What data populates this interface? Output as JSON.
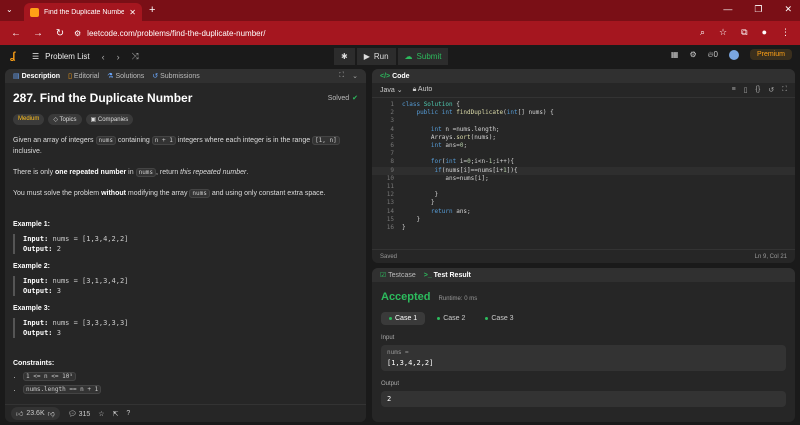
{
  "browser": {
    "tab_title": "Find the Duplicate Number - Le",
    "url": "leetcode.com/problems/find-the-duplicate-number/"
  },
  "nav": {
    "problem_list": "Problem List",
    "run": "Run",
    "submit": "Submit",
    "fire_count": "0",
    "premium": "Premium"
  },
  "desc_tabs": [
    "Description",
    "Editorial",
    "Solutions",
    "Submissions"
  ],
  "problem": {
    "title": "287. Find the Duplicate Number",
    "status": "Solved",
    "chips": [
      "Medium",
      "Topics",
      "Companies"
    ],
    "p1_a": "Given an array of integers",
    "p1_code1": "nums",
    "p1_b": "containing",
    "p1_code2": "n + 1",
    "p1_c": "integers where each integer is in the range",
    "p1_code3": "[1, n]",
    "p1_d": "inclusive.",
    "p2_a": "There is only",
    "p2_b": "one repeated number",
    "p2_c": "in",
    "p2_code": "nums",
    "p2_d": ", return",
    "p2_e": "this repeated number",
    "p3_a": "You must solve the problem",
    "p3_b": "without",
    "p3_c": "modifying the array",
    "p3_code": "nums",
    "p3_d": "and using only constant extra space.",
    "examples": [
      {
        "title": "Example 1:",
        "input": "nums = [1,3,4,2,2]",
        "output": "2"
      },
      {
        "title": "Example 2:",
        "input": "nums = [3,1,3,4,2]",
        "output": "3"
      },
      {
        "title": "Example 3:",
        "input": "nums = [3,3,3,3,3]",
        "output": "3"
      }
    ],
    "input_label": "Input:",
    "output_label": "Output:",
    "constraints_title": "Constraints:",
    "constraints": [
      "1 <= n <= 10⁵",
      "nums.length == n + 1"
    ]
  },
  "desc_footer": {
    "likes": "23.6K",
    "comments": "315"
  },
  "code": {
    "tab": "Code",
    "language": "Java",
    "mode": "Auto",
    "status": "Saved",
    "cursor": "Ln 9, Col 21"
  },
  "result": {
    "tabs": [
      "Testcase",
      "Test Result"
    ],
    "verdict": "Accepted",
    "runtime": "Runtime: 0 ms",
    "cases": [
      "Case 1",
      "Case 2",
      "Case 3"
    ],
    "input_label": "Input",
    "var_label": "nums =",
    "input_value": "[1,3,4,2,2]",
    "output_label": "Output",
    "output_value": "2"
  }
}
